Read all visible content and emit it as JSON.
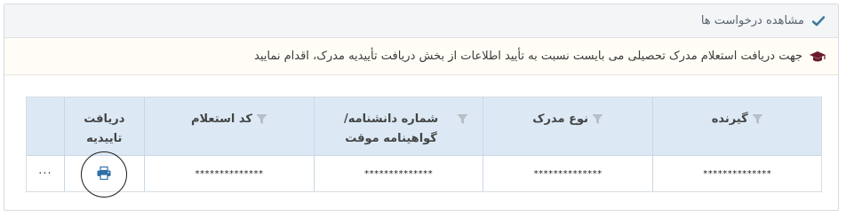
{
  "panel": {
    "title": "مشاهده درخواست ها",
    "notice": "جهت دریافت استعلام مدرک تحصیلی می بایست نسبت به تأیید اطلاعات از بخش دریافت تأییدیه مدرک، اقدام نمایید"
  },
  "table": {
    "columns": [
      "گیرنده",
      "نوع مدرک",
      "شماره دانشنامه/گواهینامه موقت",
      "کد استعلام",
      "دریافت تاییدیه"
    ],
    "rows": [
      {
        "receiver": "**************",
        "doc_type": "**************",
        "certificate_number": "**************",
        "inquiry_code": "**************",
        "more": "···"
      }
    ]
  },
  "icons": {
    "heading": "check-icon",
    "notice": "graduation-cap-icon",
    "filter": "filter-icon",
    "action": "print-icon"
  },
  "colors": {
    "header_bg": "#dce9f5",
    "accent": "#2e6ea6",
    "check": "#3d7a9a",
    "notice_icon": "#6b1a2a"
  }
}
